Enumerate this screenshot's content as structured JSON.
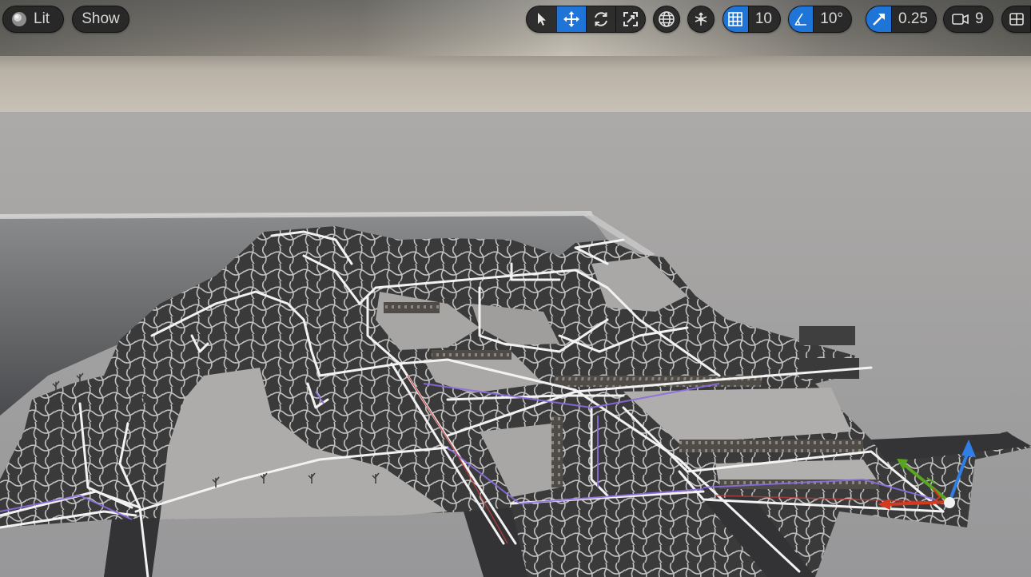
{
  "toolbar": {
    "view_mode_label": "Lit",
    "show_label": "Show",
    "grid_snap_value": "10",
    "rotation_snap_value": "10°",
    "scale_snap_value": "0.25",
    "camera_speed_value": "9"
  },
  "icons": {
    "view_mode": "sphere-icon",
    "select": "cursor-icon",
    "translate": "move-arrows-icon",
    "rotate": "rotate-icon",
    "scale": "scale-icon",
    "coordinate_space": "globe-icon",
    "surface_snapping": "surface-snap-icon",
    "grid_snap": "grid-icon",
    "rotation_snap": "angle-icon",
    "scale_snap": "diagonal-arrow-icon",
    "camera_speed": "video-camera-icon",
    "viewport_layout": "layout-icon"
  },
  "colors": {
    "active_toggle": "#1f74d8",
    "toolbar_bg": "#242424",
    "gizmo_x": "#d63a1e",
    "gizmo_y": "#5aa51f",
    "gizmo_z": "#2f7fe6"
  }
}
